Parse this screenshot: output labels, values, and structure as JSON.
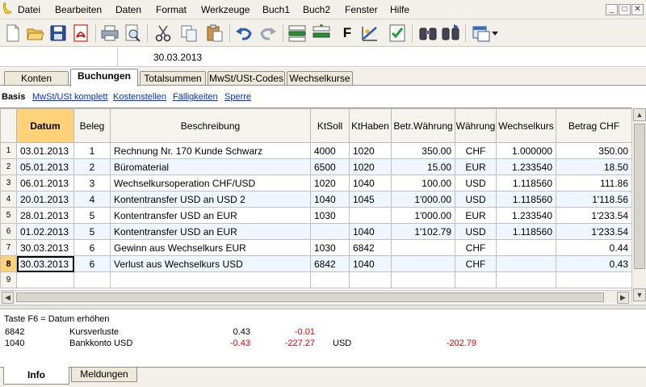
{
  "menu": {
    "items": [
      "Datei",
      "Bearbeiten",
      "Daten",
      "Format",
      "Werkzeuge",
      "Buch1",
      "Buch2",
      "Fenster",
      "Hilfe"
    ],
    "window_controls": [
      "_",
      "□",
      "✕"
    ]
  },
  "toolbar": {
    "buttons": [
      "new-file",
      "open-folder",
      "save",
      "pdf",
      "print",
      "print-preview",
      "cut",
      "copy",
      "paste",
      "undo",
      "redo",
      "insert-row",
      "duplicate-row",
      "format-bold",
      "chart",
      "checklist",
      "find",
      "find-next",
      "window-dropdown"
    ],
    "bold_label": "F"
  },
  "address": {
    "left": "",
    "value": "30.03.2013"
  },
  "tabs": [
    {
      "label": "Konten",
      "active": false
    },
    {
      "label": "Buchungen",
      "active": true
    },
    {
      "label": "Totalsummen",
      "active": false
    },
    {
      "label": "MwSt/USt-Codes",
      "active": false
    },
    {
      "label": "Wechselkurse",
      "active": false
    }
  ],
  "subnav": {
    "active": "Basis",
    "links": [
      "MwSt/USt komplett",
      "Kostenstellen",
      "Fälligkeiten",
      "Sperre"
    ]
  },
  "table": {
    "headers": [
      "Datum",
      "Beleg",
      "Beschreibung",
      "KtSoll",
      "KtHaben",
      "Betr.Währung",
      "Währung",
      "Wechselkurs",
      "Betrag CHF"
    ],
    "rows": [
      {
        "n": "1",
        "datum": "03.01.2013",
        "beleg": "1",
        "beschreibung": "Rechnung Nr. 170 Kunde Schwarz",
        "soll": "4000",
        "haben": "1020",
        "betr": "350.00",
        "waehrung": "CHF",
        "kurs": "1.000000",
        "betrag": "350.00"
      },
      {
        "n": "2",
        "datum": "05.01.2013",
        "beleg": "2",
        "beschreibung": "Büromaterial",
        "soll": "6500",
        "haben": "1020",
        "betr": "15.00",
        "waehrung": "EUR",
        "kurs": "1.233540",
        "betrag": "18.50"
      },
      {
        "n": "3",
        "datum": "06.01.2013",
        "beleg": "3",
        "beschreibung": "Wechselkursoperation CHF/USD",
        "soll": "1020",
        "haben": "1040",
        "betr": "100.00",
        "waehrung": "USD",
        "kurs": "1.118560",
        "betrag": "111.86"
      },
      {
        "n": "4",
        "datum": "20.01.2013",
        "beleg": "4",
        "beschreibung": "Kontentransfer USD an USD 2",
        "soll": "1040",
        "haben": "1045",
        "betr": "1'000.00",
        "waehrung": "USD",
        "kurs": "1.118560",
        "betrag": "1'118.56"
      },
      {
        "n": "5",
        "datum": "28.01.2013",
        "beleg": "5",
        "beschreibung": "Kontentransfer USD an EUR",
        "soll": "1030",
        "haben": "",
        "betr": "1'000.00",
        "waehrung": "EUR",
        "kurs": "1.233540",
        "betrag": "1'233.54"
      },
      {
        "n": "6",
        "datum": "01.02.2013",
        "beleg": "5",
        "beschreibung": "Kontentransfer USD an EUR",
        "soll": "",
        "haben": "1040",
        "betr": "1'102.79",
        "waehrung": "USD",
        "kurs": "1.118560",
        "betrag": "1'233.54"
      },
      {
        "n": "7",
        "datum": "30.03.2013",
        "beleg": "6",
        "beschreibung": "Gewinn aus Wechselkurs EUR",
        "soll": "1030",
        "haben": "6842",
        "betr": "",
        "waehrung": "CHF",
        "kurs": "",
        "betrag": "0.44"
      },
      {
        "n": "8",
        "datum": "30.03.2013",
        "beleg": "6",
        "beschreibung": "Verlust aus Wechselkurs USD",
        "soll": "6842",
        "haben": "1040",
        "betr": "",
        "waehrung": "CHF",
        "kurs": "",
        "betrag": "0.43"
      },
      {
        "n": "9",
        "datum": "",
        "beleg": "",
        "beschreibung": "",
        "soll": "",
        "haben": "",
        "betr": "",
        "waehrung": "",
        "kurs": "",
        "betrag": ""
      }
    ],
    "current_row": "8"
  },
  "info": {
    "hint": "Taste F6 = Datum erhöhen",
    "rows": [
      {
        "account": "6842",
        "name": "Kursverluste",
        "amount": "0.43",
        "delta": "-0.01",
        "currency": "",
        "currency_amount": ""
      },
      {
        "account": "1040",
        "name": "Bankkonto USD",
        "amount": "-0.43",
        "delta": "-227.27",
        "currency": "USD",
        "currency_amount": "-202.79"
      }
    ]
  },
  "bottom_tabs": [
    {
      "label": "Info",
      "active": true
    },
    {
      "label": "Meldungen",
      "active": false
    }
  ],
  "colors": {
    "sorted_header": "#ffd27a",
    "negative": "#e00000",
    "link": "#0033cc"
  }
}
